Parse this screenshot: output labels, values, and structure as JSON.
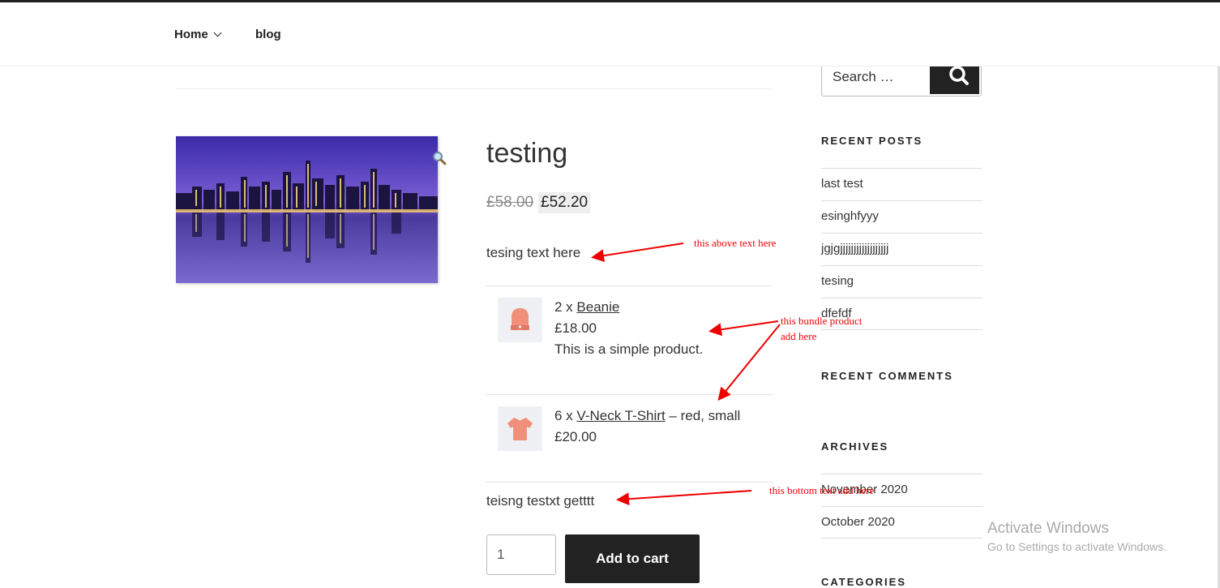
{
  "nav": {
    "home": "Home",
    "blog": "blog"
  },
  "product": {
    "title": "testing",
    "price_old": "£58.00",
    "price_new": "£52.20",
    "text_above": "tesing text here",
    "text_below": "teisng testxt getttt",
    "bundle_items": [
      {
        "qty_prefix": "2 x ",
        "name": "Beanie",
        "suffix": "",
        "price": "£18.00",
        "description": "This is a simple product."
      },
      {
        "qty_prefix": "6 x ",
        "name": "V-Neck T-Shirt",
        "suffix": " – red, small",
        "price": "£20.00",
        "description": ""
      }
    ],
    "quantity": "1",
    "add_to_cart": "Add to cart"
  },
  "sidebar": {
    "search_placeholder": "Search …",
    "recent_posts_title": "RECENT POSTS",
    "recent_posts": [
      "last test",
      "esinghfyyy",
      "jgjgjjjjjjjjjjjjjjjjjj",
      "tesing",
      "dfefdf"
    ],
    "recent_comments_title": "RECENT COMMENTS",
    "archives_title": "ARCHIVES",
    "archives": [
      "November 2020",
      "October 2020"
    ],
    "categories_title": "CATEGORIES"
  },
  "annotations": {
    "above": "this above text here",
    "bundle_line1": "this bundle product",
    "bundle_line2": "add here",
    "bottom": "this bottom text add here"
  },
  "watermark": {
    "title": "Activate Windows",
    "subtitle": "Go to Settings to activate Windows."
  },
  "colors": {
    "annotation": "#e00000",
    "button": "#222222"
  }
}
